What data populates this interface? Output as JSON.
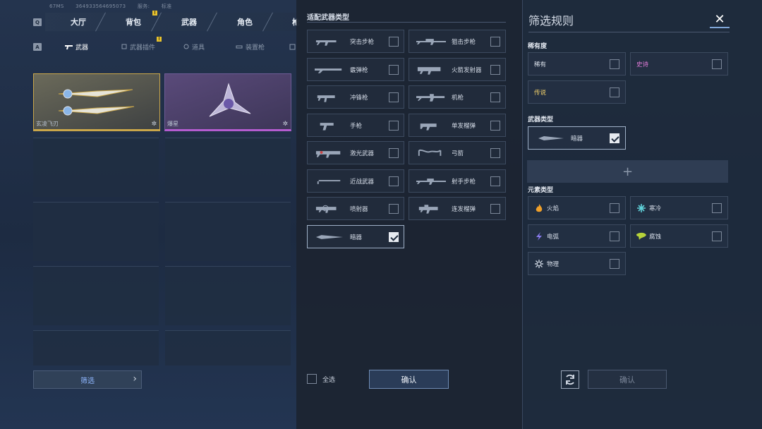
{
  "status": {
    "ping": "67MS",
    "uid": "364933564695073",
    "server_label": "服务:",
    "server_value": "标准"
  },
  "nav_main": {
    "key": "Q",
    "items": [
      "大厅",
      "背包",
      "武器",
      "角色",
      "枪"
    ]
  },
  "nav_sub": {
    "key": "A",
    "items": [
      "武器",
      "武器插件",
      "道具",
      "装置枪"
    ]
  },
  "inventory": [
    {
      "name": "玄凌飞刃",
      "rarity_color": "#c9a64a"
    },
    {
      "name": "爆星",
      "rarity_color": "#b45cd0"
    }
  ],
  "filter_button": {
    "label": "筛选",
    "chevron": "›"
  },
  "weapon_panel": {
    "title": "适配武器类型",
    "items": [
      {
        "label": "突击步枪",
        "checked": false,
        "icon": "assault-rifle-icon"
      },
      {
        "label": "狙击步枪",
        "checked": false,
        "icon": "sniper-rifle-icon"
      },
      {
        "label": "霰弹枪",
        "checked": false,
        "icon": "shotgun-icon"
      },
      {
        "label": "火箭发射器",
        "checked": false,
        "icon": "rocket-launcher-icon"
      },
      {
        "label": "冲锋枪",
        "checked": false,
        "icon": "smg-icon"
      },
      {
        "label": "机枪",
        "checked": false,
        "icon": "machine-gun-icon"
      },
      {
        "label": "手枪",
        "checked": false,
        "icon": "pistol-icon"
      },
      {
        "label": "单发榴弹",
        "checked": false,
        "icon": "grenade-launcher-icon"
      },
      {
        "label": "激光武器",
        "checked": false,
        "icon": "laser-weapon-icon"
      },
      {
        "label": "弓箭",
        "checked": false,
        "icon": "bow-icon"
      },
      {
        "label": "近战武器",
        "checked": false,
        "icon": "melee-weapon-icon"
      },
      {
        "label": "射手步枪",
        "checked": false,
        "icon": "marksman-rifle-icon"
      },
      {
        "label": "喷射器",
        "checked": false,
        "icon": "sprayer-icon"
      },
      {
        "label": "连发榴弹",
        "checked": false,
        "icon": "auto-grenade-icon"
      },
      {
        "label": "暗器",
        "checked": true,
        "icon": "throwing-knife-icon"
      }
    ],
    "select_all": "全选",
    "confirm": "确认"
  },
  "filter_panel": {
    "title": "筛选规则",
    "close": "✕",
    "rarity_title": "稀有度",
    "rarity": [
      {
        "label": "稀有",
        "color": "#dfe5ee",
        "checked": false
      },
      {
        "label": "史诗",
        "color": "#e07bd8",
        "checked": false
      },
      {
        "label": "传说",
        "color": "#f0cf6a",
        "checked": false
      }
    ],
    "weapon_type_title": "武器类型",
    "weapon_type": [
      {
        "label": "暗器",
        "checked": true
      }
    ],
    "add": "+",
    "element_title": "元素类型",
    "elements": [
      {
        "label": "火焰",
        "icon": "fire-icon",
        "color": "#f0a02a",
        "checked": false
      },
      {
        "label": "寒冷",
        "icon": "ice-icon",
        "color": "#5fd0d8",
        "checked": false
      },
      {
        "label": "电弧",
        "icon": "lightning-icon",
        "color": "#8a7cf0",
        "checked": false
      },
      {
        "label": "腐蚀",
        "icon": "corrosion-icon",
        "color": "#b6d23a",
        "checked": false
      },
      {
        "label": "物理",
        "icon": "physical-icon",
        "color": "#c8d0dc",
        "checked": false
      }
    ],
    "confirm": "确认"
  }
}
